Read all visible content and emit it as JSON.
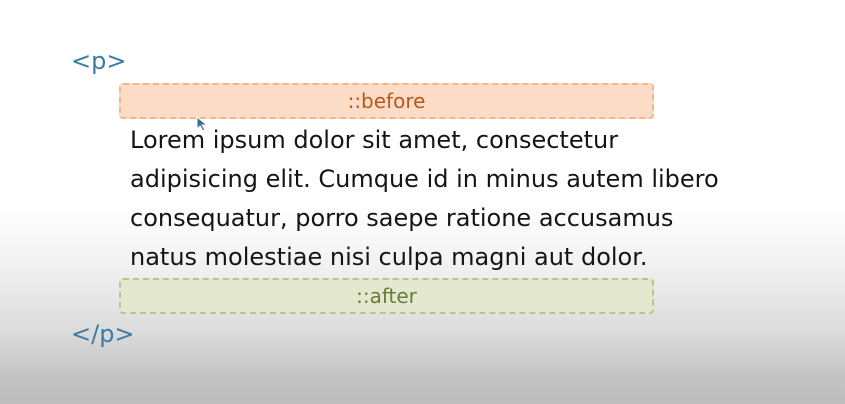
{
  "diagram": {
    "open_tag": "<p>",
    "close_tag": "</p>",
    "before_label": "::before",
    "after_label": "::after",
    "paragraph": "Lorem ipsum dolor sit amet, consectetur\nadipisicing elit. Cumque id in minus autem libero\nconsequatur, porro saepe ratione accusamus\nnatus molestiae nisi culpa magni aut dolor."
  },
  "colors": {
    "tag": "#3a7ca5",
    "before_fill": "#fcdcc6",
    "before_text": "#b45b1b",
    "after_fill": "#e3e8cf",
    "after_text": "#6b7a3a"
  }
}
